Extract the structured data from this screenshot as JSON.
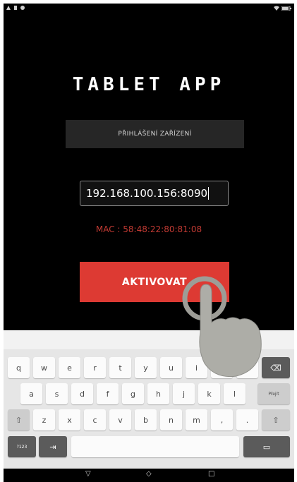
{
  "status_bar": {
    "left_icons": [
      "notification-icon",
      "notification-icon",
      "notification-icon"
    ],
    "right_icons": [
      "wifi-icon",
      "battery-icon"
    ]
  },
  "app": {
    "title": "TABLET APP",
    "header": "PŘIHLÁŠENÍ ZAŘÍZENÍ",
    "ip_value": "192.168.100.156:8090",
    "mac_label": "MAC : 58:48:22:80:81:08",
    "activate_label": "AKTIVOVAT"
  },
  "keyboard": {
    "row1": [
      "q",
      "w",
      "e",
      "r",
      "t",
      "y",
      "u",
      "i",
      "o",
      "p"
    ],
    "row2": [
      "a",
      "s",
      "d",
      "f",
      "g",
      "h",
      "j",
      "k",
      "l"
    ],
    "row3": [
      "z",
      "x",
      "c",
      "v",
      "b",
      "n",
      "m",
      ",",
      "."
    ],
    "enter_label": "Přejít",
    "symbols_label": "?123",
    "backspace": "⌫",
    "shift": "⇧",
    "tab": "⇥",
    "keyboard_switch": "▭"
  },
  "navbar": {
    "back": "▽",
    "home": "◇",
    "recents": "□"
  },
  "colors": {
    "accent": "#dd3a33",
    "mac_text": "#c23a33",
    "background": "#000000"
  }
}
